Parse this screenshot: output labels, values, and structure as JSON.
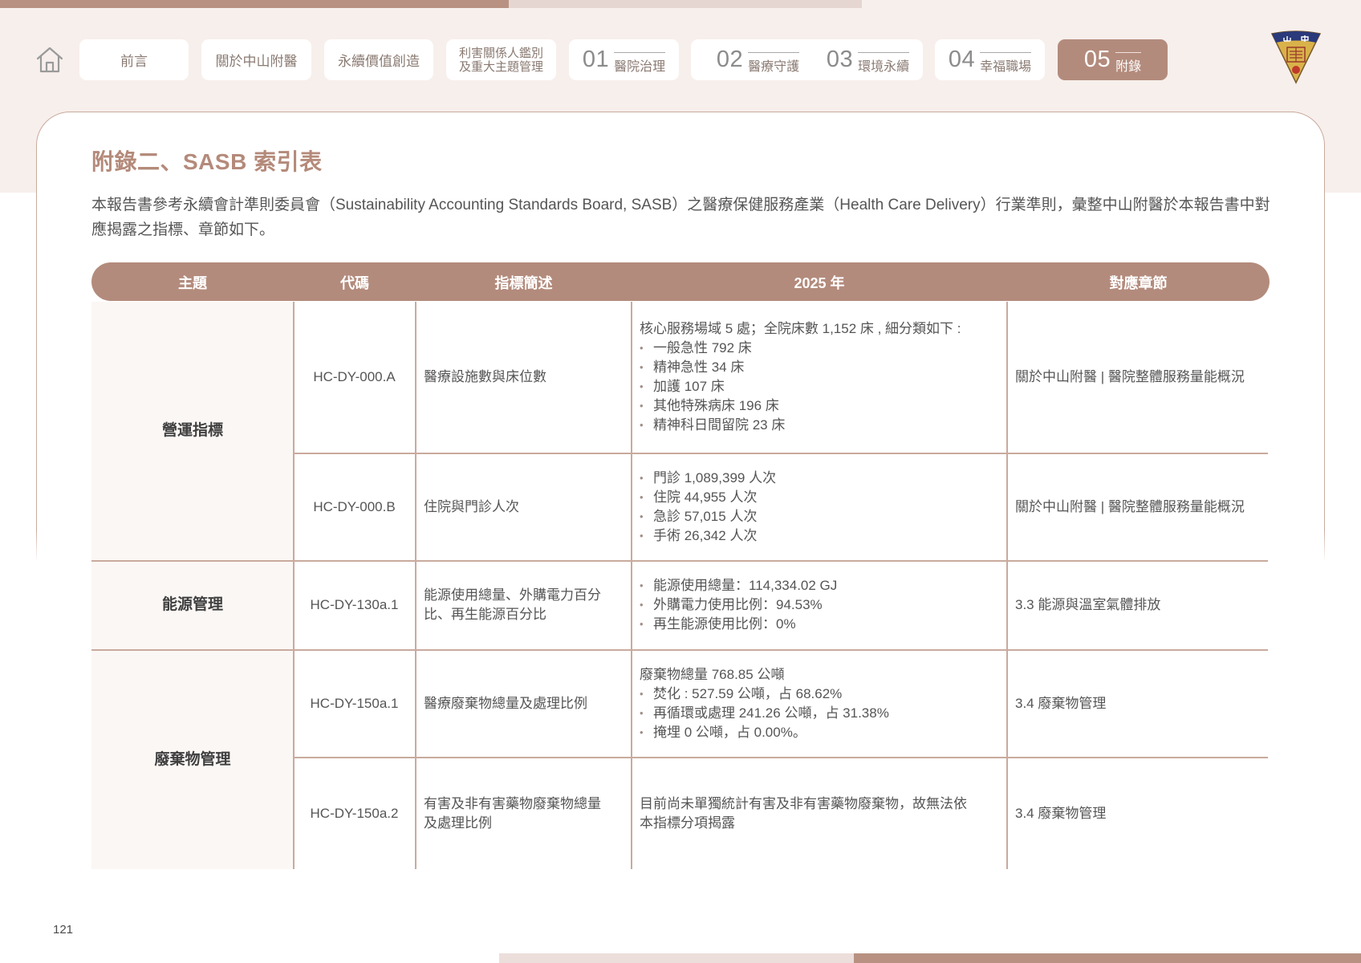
{
  "nav": {
    "tabs": [
      {
        "label": "前言"
      },
      {
        "label": "關於中山附醫"
      },
      {
        "label": "永續價值創造"
      },
      {
        "line1": "利害關係人鑑別",
        "line2": "及重大主題管理"
      },
      {
        "num": "01",
        "label": "醫院治理"
      },
      {
        "num": "02",
        "label": "醫療守護"
      },
      {
        "num": "03",
        "label": "環境永續"
      },
      {
        "num": "04",
        "label": "幸福職場"
      },
      {
        "num": "05",
        "label": "附錄"
      }
    ],
    "logo_text": "山中 醫"
  },
  "page": {
    "title": "附錄二、SASB 索引表",
    "intro": "本報告書參考永續會計準則委員會（Sustainability Accounting Standards Board, SASB）之醫療保健服務產業（Health Care Delivery）行業準則，彙整中山附醫於本報告書中對應揭露之指標、章節如下。",
    "number": "121"
  },
  "table": {
    "headers": [
      "主題",
      "代碼",
      "指標簡述",
      "2025 年",
      "對應章節"
    ],
    "topics": [
      "營運指標",
      "能源管理",
      "廢棄物管理"
    ],
    "rows": [
      {
        "code": "HC-DY-000.A",
        "desc": "醫療設施數與床位數",
        "lead": "核心服務場域 5 處；全院床數 1,152 床 , 細分類如下 :",
        "bullets": [
          "一般急性 792 床",
          "精神急性 34 床",
          "加護 107 床",
          "其他特殊病床 196 床",
          "精神科日間留院 23 床"
        ],
        "section": "關於中山附醫 | 醫院整體服務量能概況"
      },
      {
        "code": "HC-DY-000.B",
        "desc": "住院與門診人次",
        "bullets": [
          "門診 1,089,399 人次",
          "住院 44,955 人次",
          "急診 57,015 人次",
          "手術 26,342 人次"
        ],
        "section": "關於中山附醫 | 醫院整體服務量能概況"
      },
      {
        "code": "HC-DY-130a.1",
        "desc_line1": "能源使用總量、外購電力百分",
        "desc_line2": "比、再生能源百分比",
        "bullets": [
          "能源使用總量：114,334.02 GJ",
          "外購電力使用比例：94.53%",
          "再生能源使用比例：0%"
        ],
        "section": "3.3 能源與溫室氣體排放"
      },
      {
        "code": "HC-DY-150a.1",
        "desc": "醫療廢棄物總量及處理比例",
        "lead": "廢棄物總量 768.85 公噸",
        "bullets": [
          "焚化 : 527.59 公噸，占 68.62%",
          "再循環或處理 241.26 公噸，占 31.38%",
          "掩埋 0 公噸，占 0.00%。"
        ],
        "section": "3.4 廢棄物管理"
      },
      {
        "code": "HC-DY-150a.2",
        "desc_line1": "有害及非有害藥物廢棄物總量",
        "desc_line2": "及處理比例",
        "text_line1": "目前尚未單獨統計有害及非有害藥物廢棄物，故無法依",
        "text_line2": "本指標分項揭露",
        "section": "3.4 廢棄物管理"
      }
    ]
  }
}
